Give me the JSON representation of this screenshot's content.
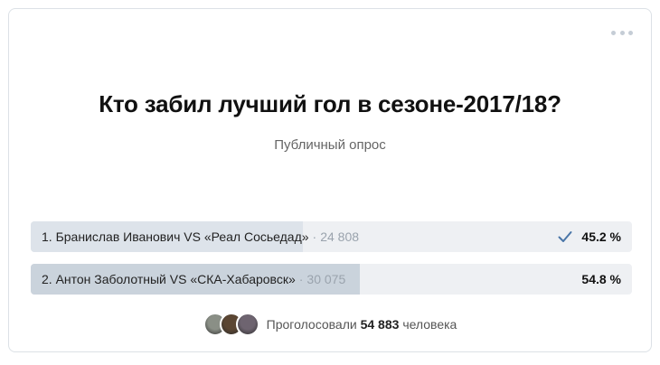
{
  "poll": {
    "title": "Кто забил лучший гол в сезоне-2017/18?",
    "type_label": "Публичный опрос",
    "answers": [
      {
        "label": "1. Бранислав Иванович VS «Реал Сосьедад»",
        "separator": "·",
        "votes": "24 808",
        "percent": "45.2 %",
        "share": 0.452,
        "selected": true
      },
      {
        "label": "2. Антон Заболотный VS «СКА-Хабаровск»",
        "separator": "·",
        "votes": "30 075",
        "percent": "54.8 %",
        "share": 0.548,
        "selected": false
      }
    ],
    "voters": {
      "prefix": "Проголосовали",
      "count": "54 883",
      "suffix": "человека",
      "avatars": [
        {
          "color": "#8a8f86"
        },
        {
          "color": "#5b4633"
        },
        {
          "color": "#6e6470"
        }
      ]
    }
  },
  "icons": {
    "more": "more-horizontal-icon",
    "check": "checkmark-icon"
  },
  "colors": {
    "accent": "#4a76a8",
    "bar_bg": "#eef0f3",
    "bar_fill": "#dde3ea",
    "bar_fill_win": "#cad3dc"
  }
}
